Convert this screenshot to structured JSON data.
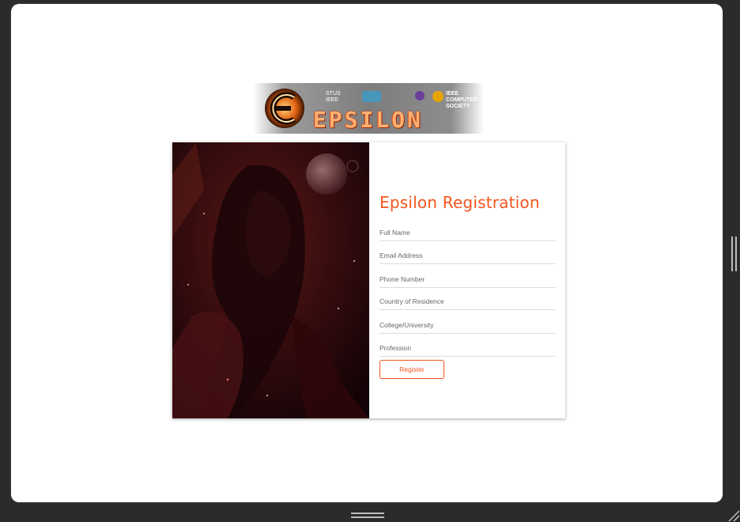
{
  "logo": {
    "wordmark": "EPSILON",
    "sponsors": [
      "STUS IEEE",
      "IEEE COMPUTER SOCIETY"
    ]
  },
  "form": {
    "title": "Epsilon Registration",
    "fields": [
      {
        "placeholder": "Full Name"
      },
      {
        "placeholder": "Email Address"
      },
      {
        "placeholder": "Phone Number"
      },
      {
        "placeholder": "Country of Residence"
      },
      {
        "placeholder": "College/University"
      },
      {
        "placeholder": "Profession"
      }
    ],
    "submit_label": "Register"
  },
  "colors": {
    "accent": "#f2551e",
    "window_background": "#2b2b2b",
    "card_background": "#ffffff"
  },
  "icons": {
    "logo_mark": "epsilon-logo-icon",
    "side_resize": "drag-handle-icon",
    "bottom_resize": "drag-handle-icon",
    "corner_resize": "resize-grip-icon"
  }
}
